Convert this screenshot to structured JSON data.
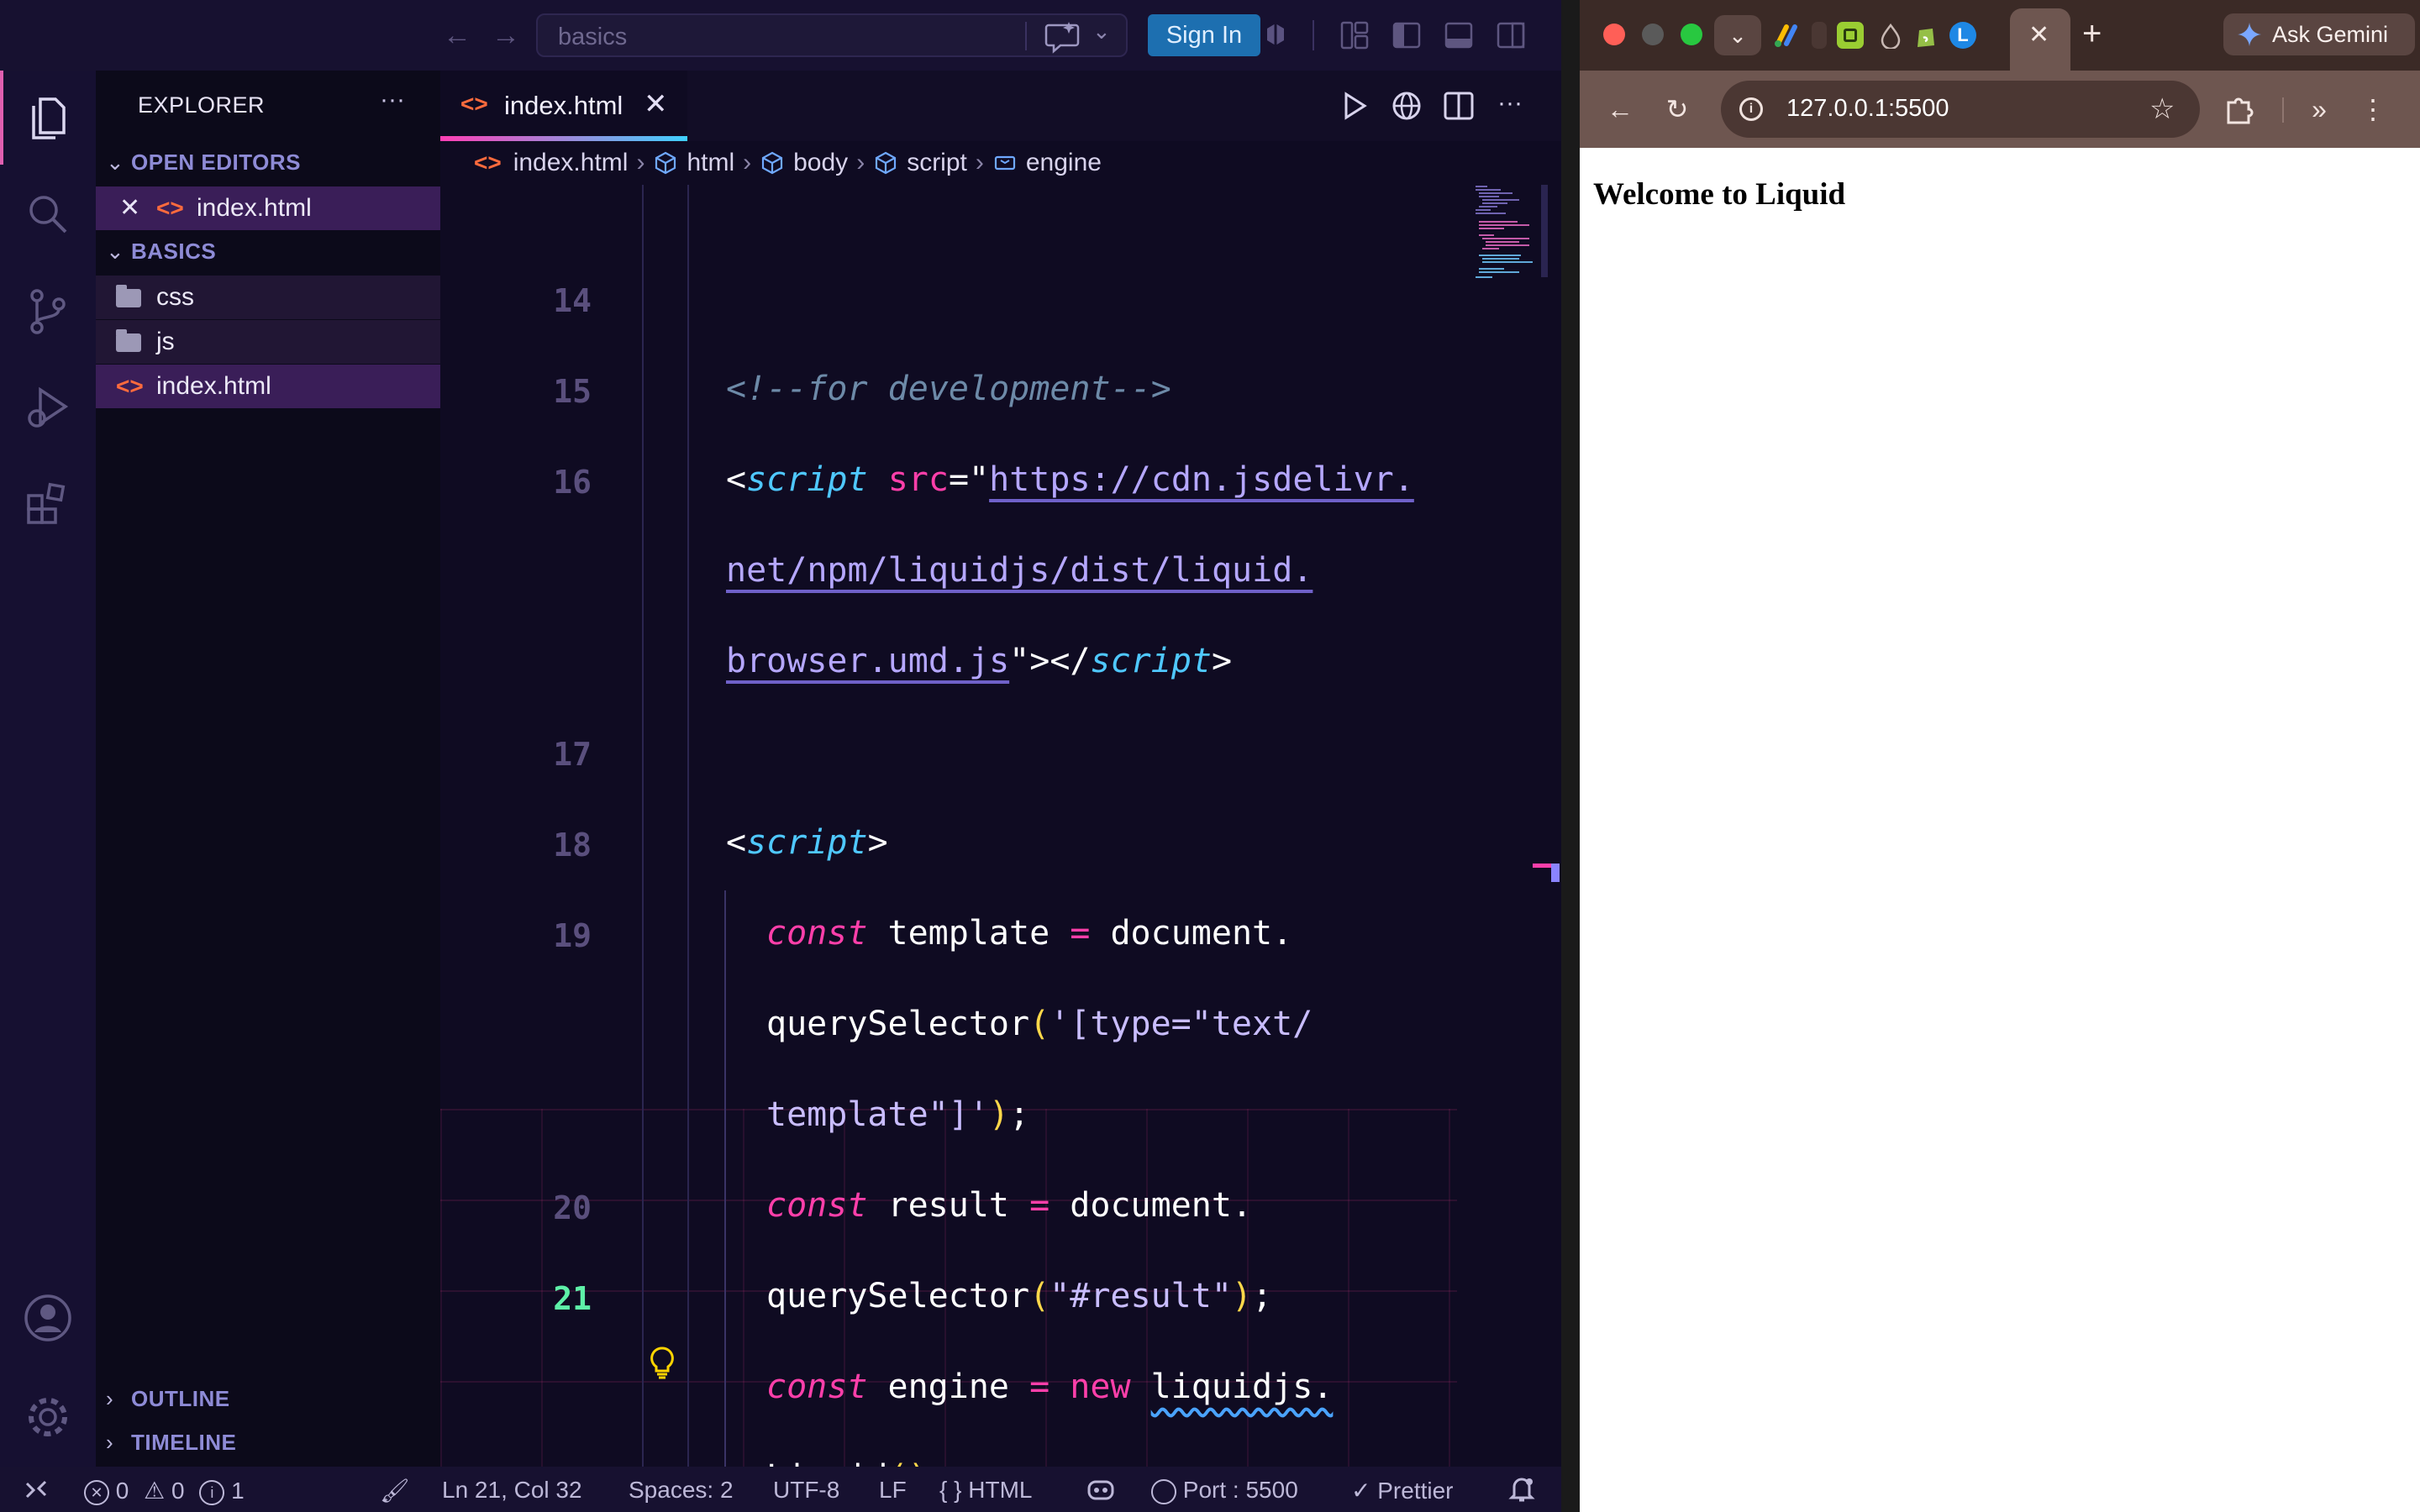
{
  "vscode": {
    "command_center": {
      "text": "basics"
    },
    "sign_in_label": "Sign In",
    "explorer": {
      "title": "EXPLORER",
      "more": "···",
      "open_editors_label": "OPEN EDITORS",
      "open_editors": [
        {
          "name": "index.html"
        }
      ],
      "project_label": "BASICS",
      "tree": [
        {
          "name": "css",
          "type": "folder"
        },
        {
          "name": "js",
          "type": "folder"
        },
        {
          "name": "index.html",
          "type": "html"
        }
      ],
      "outline_label": "OUTLINE",
      "timeline_label": "TIMELINE"
    },
    "tab": {
      "label": "index.html",
      "close": "✕"
    },
    "editor_more": "···",
    "breadcrumb": [
      "index.html",
      "html",
      "body",
      "script",
      "engine"
    ],
    "code": {
      "line_numbers": [
        "14",
        "15",
        "16",
        "17",
        "18",
        "19",
        "20",
        "21"
      ],
      "current_line": "21",
      "comment": "<!--for development-->",
      "script_src_url_1": "https://cdn.jsdelivr.",
      "script_src_url_2": "net/npm/liquidjs/dist/liquid.",
      "script_src_url_3": "browser.umd.js",
      "l19_a": "template",
      "l19_b": "document.",
      "l19_c": "querySelector",
      "l19_str1": "'[type=\"text/",
      "l19_str2": "template\"]'",
      "l20_a": "result",
      "l20_b": "document.",
      "l20_c": "querySelector",
      "l20_str": "\"#result\"",
      "l21_a": "engine",
      "l21_b": "liquidjs.",
      "l21_c": "Liquid",
      "kw_const": "const",
      "kw_new": "new",
      "tag_script": "script",
      "attr_src": "src"
    },
    "status": {
      "errors": "0",
      "warnings": "0",
      "info": "1",
      "position": "Ln 21, Col 32",
      "spaces": "Spaces: 2",
      "encoding": "UTF-8",
      "eol": "LF",
      "language_glyph": "{ }",
      "language": "HTML",
      "port": "Port : 5500",
      "prettier": "Prettier"
    }
  },
  "chrome": {
    "active_tab_close": "✕",
    "new_tab": "+",
    "gemini_label": "Ask Gemini",
    "address": "127.0.0.1:5500",
    "page_heading": "Welcome to Liquid",
    "colors": {
      "close": "#ff5f57",
      "minimize": "#5a5a5a",
      "maximize": "#28c840"
    }
  }
}
